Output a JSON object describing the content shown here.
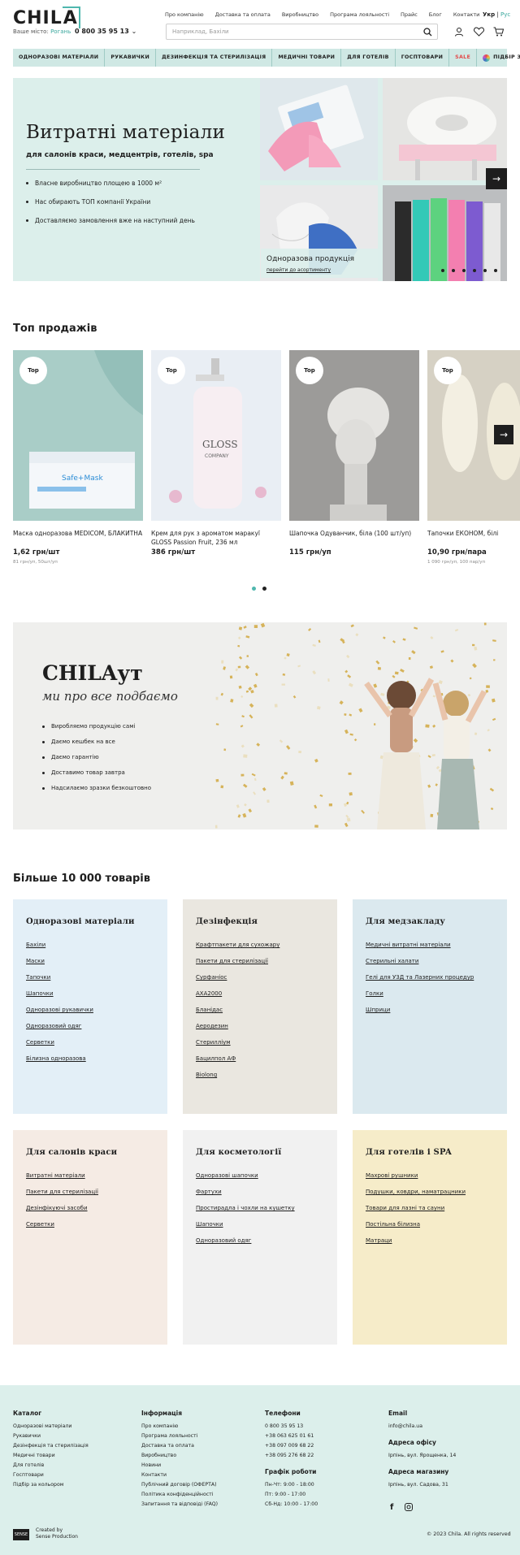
{
  "header": {
    "logo": "CHILA",
    "city_label": "Ваше місто:",
    "city_value": "Рогань",
    "phone": "0 800 35 95 13",
    "nav": [
      "Про компанію",
      "Доставка та оплата",
      "Виробництво",
      "Програма лояльності",
      "Прайс",
      "Блог",
      "Контакти"
    ],
    "lang_active": "Укр",
    "lang_other": "Рус",
    "search_placeholder": "Наприклад, Бахіли"
  },
  "categories_bar": [
    "ОДНОРАЗОВІ МАТЕРІАЛИ",
    "РУКАВИЧКИ",
    "ДЕЗИНФЕКЦІЯ ТА СТЕРИЛІЗАЦІЯ",
    "МЕДИЧНІ ТОВАРИ",
    "ДЛЯ ГОТЕЛІВ",
    "ГОСПТОВАРИ",
    "SALE",
    "ПІДБІР ЗА КОЛЬОРОМ"
  ],
  "hero": {
    "title": "Витратні матеріали",
    "subtitle": "для салонів краси, медцентрів, готелів, spa",
    "bullets": [
      "Власне виробництво площею в 1000 м²",
      "Нас обирають ТОП компанії України",
      "Доставляємо замовлення вже на наступний день"
    ],
    "caption_title": "Одноразова продукція",
    "caption_link": "перейти до асортименту"
  },
  "top_sales": {
    "title": "Топ продажів",
    "badge": "Top",
    "products": [
      {
        "name": "Маска одноразова MEDICOM, БЛАКИТНА",
        "price": "1,62 грн/шт",
        "sub": "81 грн/уп, 50шт/уп",
        "img": "mask"
      },
      {
        "name": "Крем для рук з ароматом маракуї GLOSS Passion Fruit, 236 мл",
        "price": "386 грн/шт",
        "sub": "",
        "img": "cream"
      },
      {
        "name": "Шапочка Одуванчик, біла (100 шт/уп)",
        "price": "115 грн/уп",
        "sub": "",
        "img": "cap"
      },
      {
        "name": "Тапочки ЕКОНОМ, білі",
        "price": "10,90 грн/пара",
        "sub": "1 090 грн/уп, 100 пар/уп",
        "img": "slippers"
      }
    ]
  },
  "banner": {
    "title": "CHILAут",
    "tagline": "ми про все подбаємо",
    "bullets": [
      "Виробляємо продукцію самі",
      "Даємо кешбек на все",
      "Даємо гарантію",
      "Доставимо товар завтра",
      "Надсилаємо зразки безкоштовно"
    ]
  },
  "more": {
    "title": "Більше 10 000 товарів",
    "categories": [
      {
        "title": "Одноразові матеріали",
        "bg": "#e3eff7",
        "links": [
          "Бахіли",
          "Маски",
          "Тапочки",
          "Шапочки",
          "Одноразові рукавички",
          "Одноразовий одяг",
          "Серветки",
          "Білизна одноразова"
        ]
      },
      {
        "title": "Дезінфекція",
        "bg": "#eae7e0",
        "links": [
          "Крафтпакети для сухожару",
          "Пакети для стерилізації",
          "Сурфаніос",
          "AXA2000",
          "Бланідас",
          "Аеродезин",
          "Стерилліум",
          "Бацилпол АФ",
          "Biolong"
        ]
      },
      {
        "title": "Для медзакладу",
        "bg": "#dbe9ef",
        "links": [
          "Медичні витратні матеріали",
          "Стерильні халати",
          "Гелі для УЗД та Лазерних процедур",
          "Голки",
          "Шприци"
        ]
      },
      {
        "title": "Для салонів краси",
        "bg": "#f5ebe4",
        "links": [
          "Витратні матеріали",
          "Пакети для стерилізації",
          "Дезінфікуючі засоби",
          "Серветки"
        ]
      },
      {
        "title": "Для косметології",
        "bg": "#f1f1f1",
        "links": [
          "Одноразові шапочки",
          "Фартухи",
          "Простирадла і чохли на кушетку",
          "Шапочки",
          "Одноразовий одяг"
        ]
      },
      {
        "title": "Для готелів і SPA",
        "bg": "#f6ecc9",
        "links": [
          "Махрові рушники",
          "Подушки, ковдри, наматрацники",
          "Товари для лазні та сауни",
          "Постільна білизна",
          "Матраци"
        ]
      }
    ]
  },
  "footer": {
    "catalog_title": "Каталог",
    "catalog": [
      "Одноразові матеріали",
      "Рукавички",
      "Дезінфекція та стерилізація",
      "Медичні товари",
      "Для готелів",
      "Госптовари",
      "Підбір за кольором"
    ],
    "info_title": "Інформація",
    "info": [
      "Про компанію",
      "Програма лояльності",
      "Доставка та оплата",
      "Виробництво",
      "Новини",
      "Контакти",
      "Публічний договір (ОФЕРТА)",
      "Політика конфіденційності",
      "Запитання та відповіді (FAQ)"
    ],
    "phones_title": "Телефони",
    "phones": [
      "0 800 35 95 13",
      "+38 063 625 01 61",
      "+38 097 009 68 22",
      "+38 095 276 68 22"
    ],
    "schedule_title": "Графік роботи",
    "schedule": [
      "Пн-Чт: 9:00 - 18:00",
      "Пт: 9:00 - 17:00",
      "Сб-Нд: 10:00 - 17:00"
    ],
    "email_title": "Email",
    "email": "info@chila.ua",
    "office_title": "Адреса офісу",
    "office": "Ірпінь, вул. Ярощенка, 14",
    "store_title": "Адреса магазину",
    "store": "Ірпінь, вул. Садова, 31",
    "created_by": "Created by",
    "created_name": "Sense Production",
    "copyright": "© 2023 Chila. All rights reserved"
  }
}
